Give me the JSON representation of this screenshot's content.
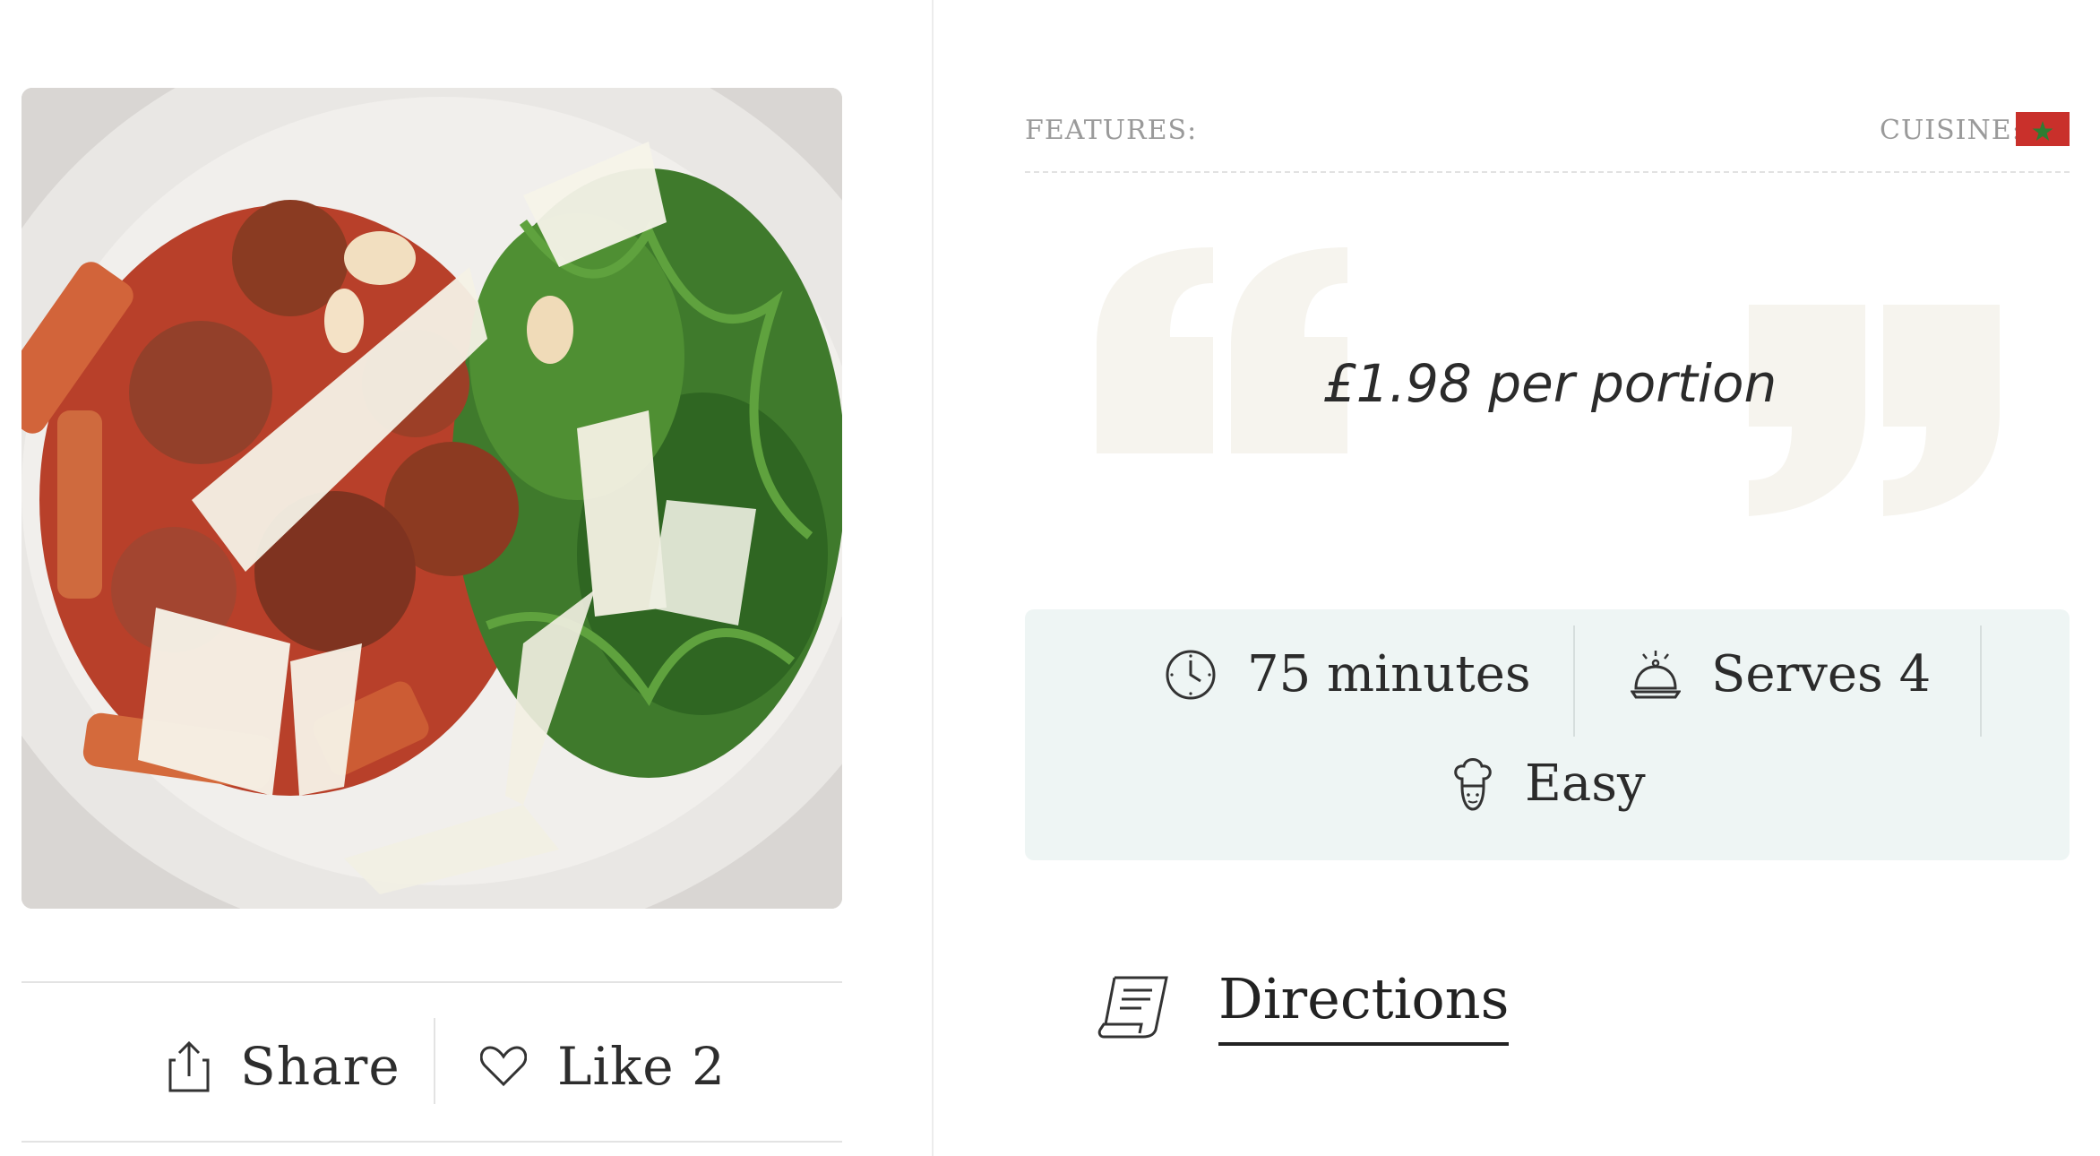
{
  "photo": {
    "subject": "pasta-with-meatballs-tomato-sauce-rocket-salad-parmesan"
  },
  "actions": {
    "share_label": "Share",
    "like_label": "Like 2"
  },
  "meta": {
    "features_label": "FEATURES:",
    "cuisine_label": "CUISINE:",
    "cuisine_flag": {
      "name": "morocco-flag-icon",
      "color": "#c9302b",
      "star_color": "#2e7d32"
    }
  },
  "quote": {
    "text": "£1.98 per portion",
    "mark_color": "#f6f4ee"
  },
  "info": {
    "time": {
      "icon": "clock-icon",
      "label": "75 minutes"
    },
    "serves": {
      "icon": "serving-dish-icon",
      "label": "Serves 4"
    },
    "difficulty": {
      "icon": "chef-hat-icon",
      "label": "Easy"
    },
    "background": "#eef5f4"
  },
  "directions": {
    "icon": "recipe-scroll-icon",
    "label": "Directions"
  }
}
